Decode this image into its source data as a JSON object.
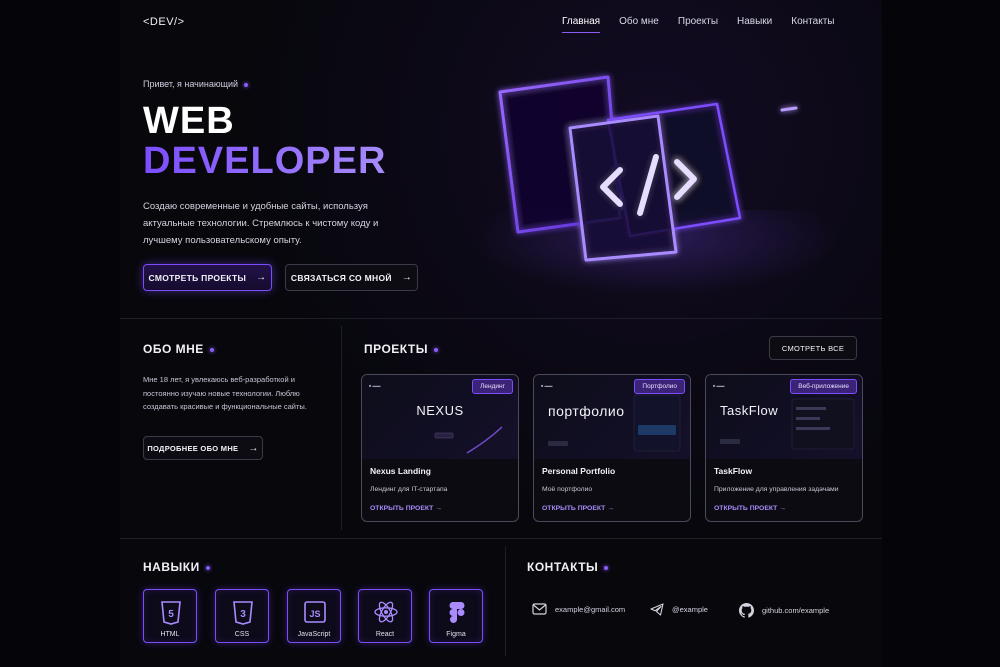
{
  "header": {
    "logo": "<DEV/>",
    "nav": [
      {
        "label": "Главная",
        "active": true
      },
      {
        "label": "Обо мне",
        "active": false
      },
      {
        "label": "Проекты",
        "active": false
      },
      {
        "label": "Навыки",
        "active": false
      },
      {
        "label": "Контакты",
        "active": false
      }
    ]
  },
  "hero": {
    "greeting": "Привет, я начинающий",
    "title_line1": "WEB",
    "title_line2": "DEVELOPER",
    "description": "Создаю современные и удобные сайты, используя актуальные технологии. Стремлюсь к чистому коду и лучшему пользовательскому опыту.",
    "primary_button": "СМОТРЕТЬ ПРОЕКТЫ",
    "secondary_button": "СВЯЗАТЬСЯ СО МНОЙ",
    "art_icon": "code-brackets-icon"
  },
  "about": {
    "title": "ОБО МНЕ",
    "text": "Мне 18 лет, я увлекаюсь веб-разработкой и постоянно изучаю новые технологии. Люблю создавать красивые и функциональные сайты.",
    "button": "ПОДРОБНЕЕ ОБО МНЕ"
  },
  "projects": {
    "title": "ПРОЕКТЫ",
    "view_all": "СМОТРЕТЬ ВСЕ",
    "items": [
      {
        "tag": "Лендинг",
        "preview": "NEXUS",
        "title": "Nexus Landing",
        "desc": "Лендинг для IT-стартапа",
        "link": "ОТКРЫТЬ ПРОЕКТ"
      },
      {
        "tag": "Портфолио",
        "preview": "портфолио",
        "title": "Personal Portfolio",
        "desc": "Моё портфолио",
        "link": "ОТКРЫТЬ ПРОЕКТ"
      },
      {
        "tag": "Веб-приложение",
        "preview": "TaskFlow",
        "title": "TaskFlow",
        "desc": "Приложение для управления задачами",
        "link": "ОТКРЫТЬ ПРОЕКТ"
      }
    ]
  },
  "skills": {
    "title": "НАВЫКИ",
    "items": [
      {
        "label": "HTML",
        "icon": "html5-icon"
      },
      {
        "label": "CSS",
        "icon": "css3-icon"
      },
      {
        "label": "JavaScript",
        "icon": "javascript-icon"
      },
      {
        "label": "React",
        "icon": "react-icon"
      },
      {
        "label": "Figma",
        "icon": "figma-icon"
      }
    ]
  },
  "contacts": {
    "title": "КОНТАКТЫ",
    "items": [
      {
        "label": "example@gmail.com",
        "icon": "mail-icon"
      },
      {
        "label": "@example",
        "icon": "telegram-icon"
      },
      {
        "label": "github.com/example",
        "icon": "github-icon"
      }
    ]
  },
  "colors": {
    "accent": "#8b5cf6",
    "background": "#050509",
    "card_border": "#4a4a5a"
  }
}
